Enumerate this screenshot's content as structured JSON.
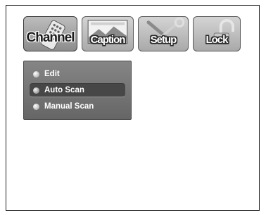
{
  "tabs": [
    {
      "label": "Channel",
      "icon": "remote-control-icon",
      "active": true
    },
    {
      "label": "Caption",
      "icon": "caption-screen-icon",
      "active": false
    },
    {
      "label": "Setup",
      "icon": "tools-icon",
      "active": false
    },
    {
      "label": "Lock",
      "icon": "padlock-icon",
      "active": false
    }
  ],
  "submenu": {
    "items": [
      {
        "label": "Edit",
        "selected": false
      },
      {
        "label": "Auto Scan",
        "selected": true
      },
      {
        "label": "Manual Scan",
        "selected": false
      }
    ]
  },
  "colors": {
    "frame_border": "#222222",
    "submenu_bg": "#777777",
    "selected_item_bg": "#474747",
    "menu_text": "#ffffff"
  }
}
